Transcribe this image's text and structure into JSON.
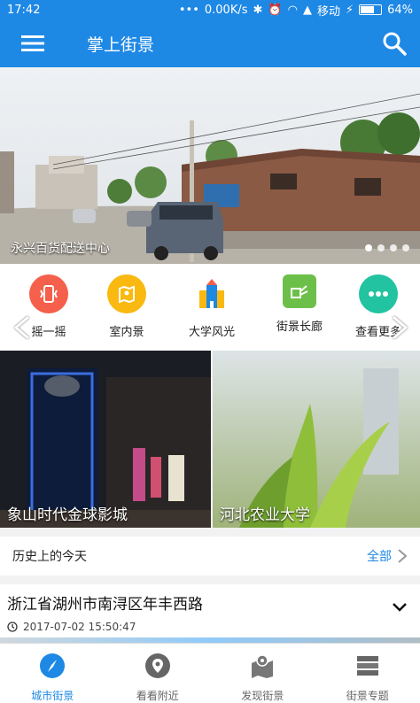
{
  "status": {
    "time": "17:42",
    "speed": "0.00K/s",
    "carrier": "移动",
    "battery": "64%"
  },
  "appbar": {
    "title": "掌上街景"
  },
  "hero": {
    "caption": "永兴百货配送中心"
  },
  "quick": [
    {
      "label": "摇一摇",
      "icon": "shake-icon",
      "color": "#f4604b"
    },
    {
      "label": "室内景",
      "icon": "map-pin-icon",
      "color": "#f9b911"
    },
    {
      "label": "大学风光",
      "icon": "university-icon",
      "color": "#ffffff"
    },
    {
      "label": "街景长廊",
      "icon": "gallery-icon",
      "color": "#6cc04a"
    },
    {
      "label": "查看更多",
      "icon": "more-icon",
      "color": "#22c3a0"
    }
  ],
  "cards": [
    {
      "caption": "象山时代金球影城"
    },
    {
      "caption": "河北农业大学"
    }
  ],
  "history": {
    "title": "历史上的今天",
    "all": "全部"
  },
  "entry": {
    "title": "浙江省湖州市南浔区年丰西路",
    "date": "2017-07-02 15:50:47"
  },
  "tabs": [
    {
      "label": "城市街景",
      "icon": "compass-icon",
      "active": true
    },
    {
      "label": "看看附近",
      "icon": "location-icon",
      "active": false
    },
    {
      "label": "发现街景",
      "icon": "discover-map-icon",
      "active": false
    },
    {
      "label": "街景专题",
      "icon": "topics-icon",
      "active": false
    }
  ],
  "colors": {
    "primary": "#1e88e5"
  }
}
